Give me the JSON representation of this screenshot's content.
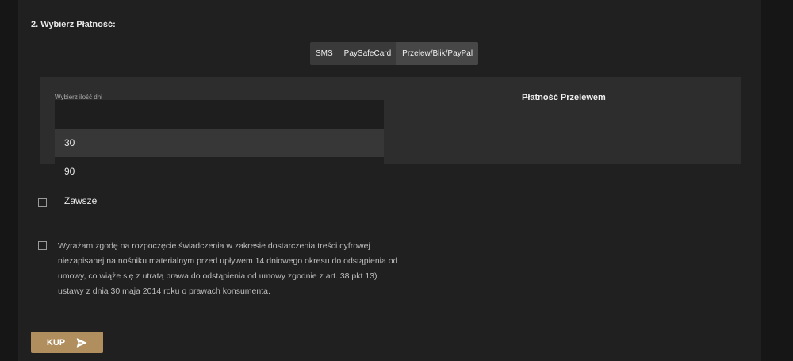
{
  "section": {
    "title": "2. Wybierz Płatność:"
  },
  "payment_tabs": [
    {
      "label": "SMS",
      "active": false
    },
    {
      "label": "PaySafeCard",
      "active": false
    },
    {
      "label": "Przelew/Blik/PayPal",
      "active": true
    }
  ],
  "days": {
    "label": "Wybierz ilość dni",
    "value": "",
    "options": [
      "30",
      "90"
    ],
    "highlighted": "30"
  },
  "przelew": {
    "title": "Płatność Przelewem"
  },
  "zawsze": {
    "label": "Zawsze",
    "checked": false
  },
  "consent": {
    "text": "Wyrażam zgodę na rozpoczęcie świadczenia w zakresie dostarczenia treści cyfrowej niezapisanej na nośniku materialnym przed upływem 14 dniowego okresu do odstąpienia od umowy, co wiąże się z utratą prawa do odstąpienia od umowy zgodnie z art. 38 pkt 13) ustawy z dnia 30 maja 2014 roku o prawach konsumenta.",
    "checked": false
  },
  "buy_button": {
    "label": "KUP",
    "icon": "send-icon"
  },
  "colors": {
    "accent": "#b08e5e",
    "background": "#161616",
    "panel": "#202020",
    "card": "#2d2d2d"
  }
}
